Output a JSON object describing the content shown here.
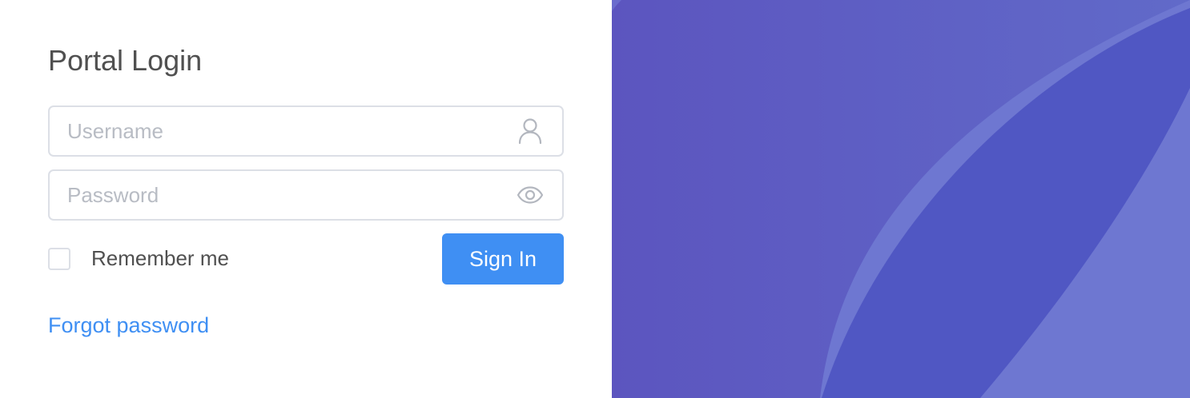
{
  "login": {
    "title": "Portal Login",
    "username": {
      "value": "",
      "placeholder": "Username",
      "icon": "user-icon"
    },
    "password": {
      "value": "",
      "placeholder": "Password",
      "icon": "eye-icon"
    },
    "remember_label": "Remember me",
    "remember_checked": false,
    "signin_label": "Sign In",
    "forgot_label": "Forgot password"
  },
  "colors": {
    "primary": "#3f8ff3",
    "text": "#505050",
    "placeholder": "#b8bcc4",
    "border": "#dcdfe6",
    "art_background": "#5f62c4",
    "art_shape_dark": "#4f55c2",
    "art_shape_light": "#6f76d0"
  }
}
